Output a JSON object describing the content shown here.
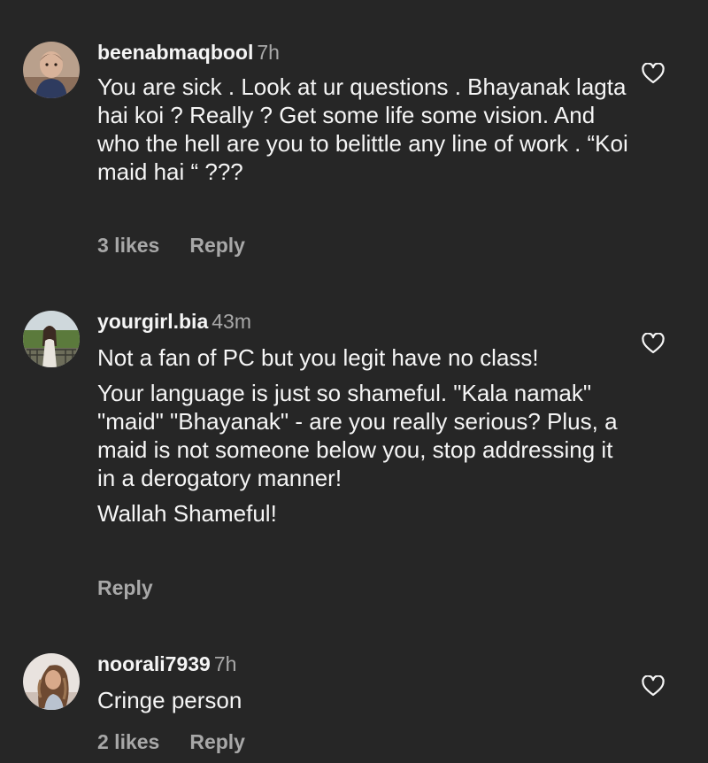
{
  "comments": [
    {
      "username": "beenabmaqbool",
      "time": "7h",
      "lines": [
        "You are sick . Look at ur questions . Bhayanak lagta hai koi ? Really ? Get some life some vision. And who the hell are you to belittle any line of work . “Koi maid hai “ ???"
      ],
      "likes": "3 likes",
      "reply": "Reply",
      "avatar_icon": "baby-avatar"
    },
    {
      "username": "yourgirl.bia",
      "time": "43m",
      "lines": [
        "Not a fan of PC but you legit have no class!",
        "Your language is just so shameful. \"Kala namak\" \"maid\" \"Bhayanak\" - are you really serious? Plus, a maid is not someone below you, stop addressing it in a derogatory manner!",
        "Wallah Shameful!"
      ],
      "likes": "",
      "reply": "Reply",
      "avatar_icon": "woman-outdoor-avatar"
    },
    {
      "username": "noorali7939",
      "time": "7h",
      "lines": [
        "Cringe person"
      ],
      "likes": "2 likes",
      "reply": "Reply",
      "avatar_icon": "woman-curly-hair-avatar"
    }
  ],
  "colors": {
    "background": "#262626",
    "text": "#f5f5f5",
    "muted": "#a8a8a8"
  },
  "icons": {
    "like": "heart-outline-icon"
  }
}
